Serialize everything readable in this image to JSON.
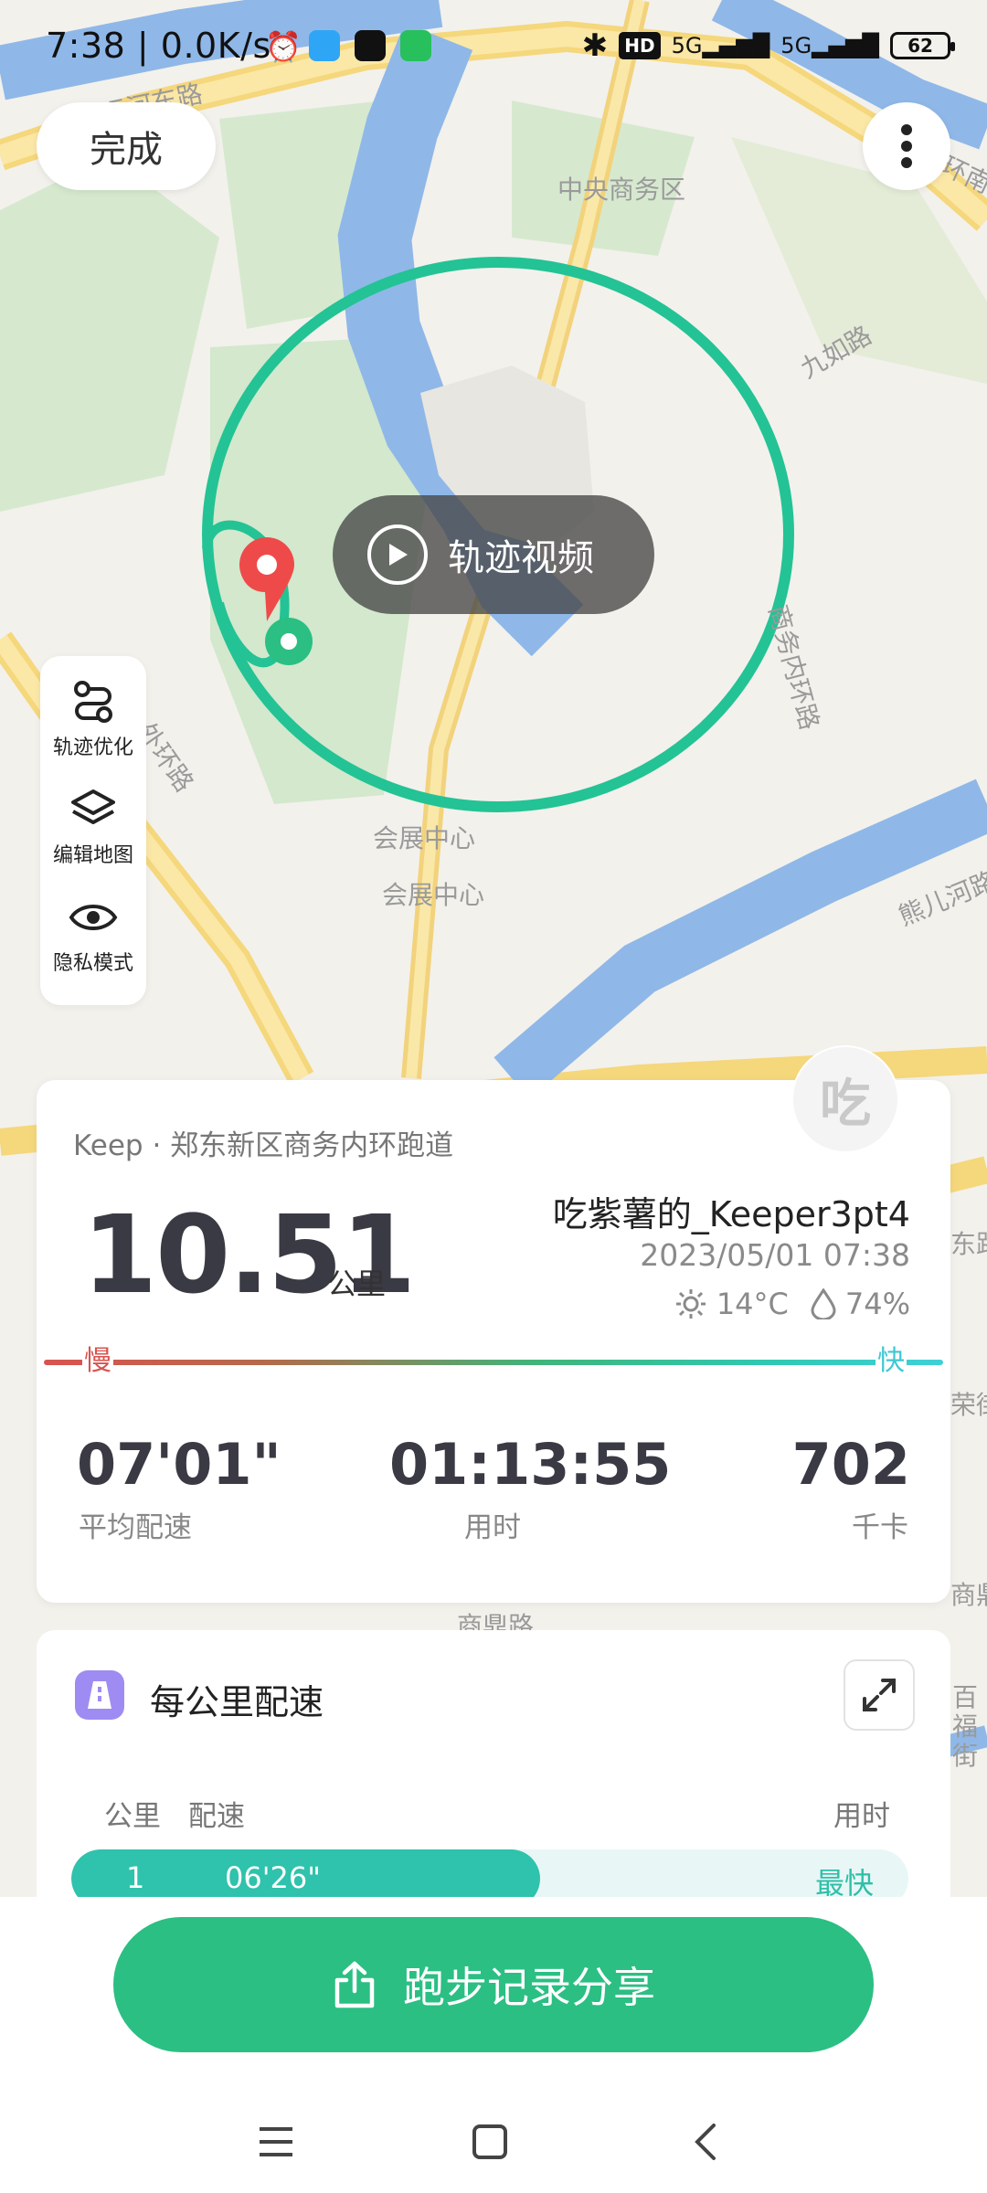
{
  "status_bar": {
    "time_speed": "7:38 | 0.0K/s",
    "net1": "5G",
    "net2": "5G",
    "hd": "HD",
    "battery": "62"
  },
  "map": {
    "labels": {
      "central_business": "中央商务区",
      "jiuru_road": "九如路",
      "inner_ring_road": "商务内环路",
      "convention_center_1": "会展中心",
      "convention_center_2": "会展中心",
      "outer_ring_road": "外环路",
      "canal_road": "运河东路",
      "xiong_er_river": "熊儿河路",
      "ring_south": "环南",
      "east_road": "东路",
      "rong_street": "荣街",
      "shangding_road": "商鼎路",
      "shangding_short": "商鼎",
      "baifu_street": "百福街",
      "bottom_road": "商鼎路"
    },
    "track_color": "#23c395"
  },
  "toolbar": {
    "done_label": "完成",
    "track_video_label": "轨迹视频"
  },
  "side_tools": [
    {
      "label": "轨迹优化",
      "icon": "route-icon"
    },
    {
      "label": "编辑地图",
      "icon": "layers-icon"
    },
    {
      "label": "隐私模式",
      "icon": "eye-icon"
    }
  ],
  "summary": {
    "avatar_text": "吃",
    "route_name": "Keep · 郑东新区商务内环跑道",
    "distance": "10.51",
    "distance_unit": "公里",
    "user_name": "吃紫薯的_Keeper3pt4",
    "date_time": "2023/05/01 07:38",
    "temperature": "14°C",
    "humidity": "74%",
    "slow_label": "慢",
    "fast_label": "快",
    "stats": [
      {
        "value": "07'01\"",
        "label": "平均配速"
      },
      {
        "value": "01:13:55",
        "label": "用时"
      },
      {
        "value": "702",
        "label": "千卡"
      }
    ]
  },
  "splits": {
    "title": "每公里配速",
    "col_km": "公里",
    "col_pace": "配速",
    "col_time": "用时",
    "rows": [
      {
        "km": "1",
        "pace": "06'26\"",
        "tag": "最快",
        "fill_fraction": 0.56
      }
    ]
  },
  "share": {
    "label": "跑步记录分享"
  }
}
